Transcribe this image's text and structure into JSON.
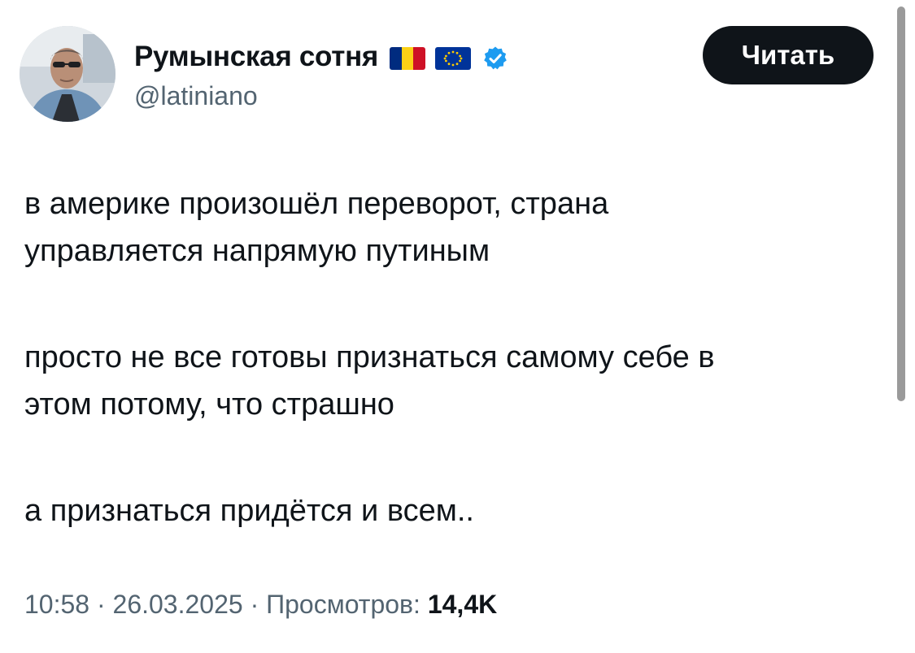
{
  "author": {
    "display_name": "Румынская сотня",
    "handle": "@latiniano",
    "verified": true,
    "flags": [
      "romania-flag",
      "eu-flag"
    ],
    "avatar_icon": "avatar-photo"
  },
  "follow_button": {
    "label": "Читать"
  },
  "tweet": {
    "paragraphs": [
      [
        "в америке произошёл переворот, страна",
        "управляется напрямую путиным"
      ],
      [
        "просто не все готовы признаться самому себе в",
        "этом потому, что страшно"
      ],
      [
        "а признаться придётся и всем.."
      ]
    ]
  },
  "meta": {
    "time": "10:58",
    "separator": " · ",
    "date": "26.03.2025",
    "views_label": "Просмотров:",
    "views_count": "14,4K"
  },
  "colors": {
    "text_primary": "#0f1419",
    "text_secondary": "#536471",
    "button_bg": "#0f1419",
    "verified_blue": "#1d9bf0",
    "romania_blue": "#002b7f",
    "romania_yellow": "#fcd116",
    "romania_red": "#ce1126",
    "eu_blue": "#003399",
    "eu_stars": "#ffcc00"
  }
}
